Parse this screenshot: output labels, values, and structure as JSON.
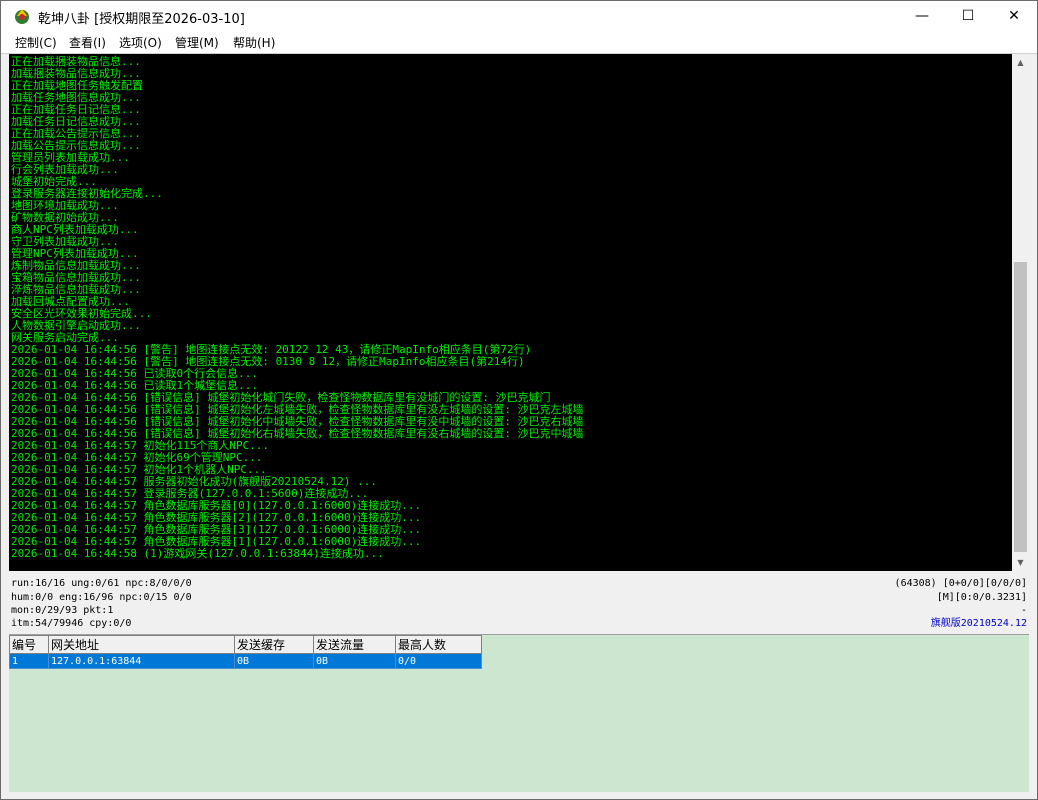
{
  "window": {
    "title": "乾坤八卦 [授权期限至2026-03-10]",
    "minimize_glyph": "—",
    "maximize_glyph": "☐",
    "close_glyph": "✕"
  },
  "menu": [
    "控制(C)",
    "查看(I)",
    "选项(O)",
    "管理(M)",
    "帮助(H)"
  ],
  "log_lines": [
    "正在加载捆装物品信息...",
    "加载捆装物品信息成功...",
    "正在加载地图任务触发配置",
    "加载任务地图信息成功...",
    "正在加载任务日记信息...",
    "加载任务日记信息成功...",
    "正在加载公告提示信息...",
    "加载公告提示信息成功...",
    "管理员列表加载成功...",
    "行会列表加载成功...",
    "城堡初始完成...",
    "登录服务器连接初始化完成...",
    "地图环境加载成功...",
    "矿物数据初始成功...",
    "商人NPC列表加载成功...",
    "守卫列表加载成功...",
    "管理NPC列表加载成功...",
    "炼制物品信息加载成功...",
    "宝箱物品信息加载成功...",
    "淬炼物品信息加载成功...",
    "加载回城点配置成功...",
    "安全区光环效果初始完成...",
    "人物数据引擎启动成功...",
    "网关服务启动完成...",
    "2026-01-04 16:44:56 [警告] 地图连接点无效: 20122 12 43，请修正MapInfo相应条目(第72行)",
    "2026-01-04 16:44:56 [警告] 地图连接点无效: 0130 8 12，请修正MapInfo相应条目(第214行)",
    "2026-01-04 16:44:56 已读取0个行会信息...",
    "2026-01-04 16:44:56 已读取1个城堡信息...",
    "2026-01-04 16:44:56 [错误信息] 城堡初始化城门失败，检查怪物数据库里有没城门的设置: 沙巴克城门",
    "2026-01-04 16:44:56 [错误信息] 城堡初始化左城墙失败，检查怪物数据库里有没左城墙的设置: 沙巴克左城墙",
    "2026-01-04 16:44:56 [错误信息] 城堡初始化中城墙失败，检查怪物数据库里有没中城墙的设置: 沙巴克右城墙",
    "2026-01-04 16:44:56 [错误信息] 城堡初始化右城墙失败，检查怪物数据库里有没右城墙的设置: 沙巴克中城墙",
    "2026-01-04 16:44:57 初始化115个商人NPC...",
    "2026-01-04 16:44:57 初始化69个管理NPC...",
    "2026-01-04 16:44:57 初始化1个机器人NPC...",
    "2026-01-04 16:44:57 服务器初始化成功(旗舰版20210524.12) ...",
    "2026-01-04 16:44:57 登录服务器(127.0.0.1:5600)连接成功...",
    "2026-01-04 16:44:57 角色数据库服务器[0](127.0.0.1:6000)连接成功...",
    "2026-01-04 16:44:57 角色数据库服务器[2](127.0.0.1:6000)连接成功...",
    "2026-01-04 16:44:57 角色数据库服务器[3](127.0.0.1:6000)连接成功...",
    "2026-01-04 16:44:57 角色数据库服务器[1](127.0.0.1:6000)连接成功...",
    "2026-01-04 16:44:58 (1)游戏网关(127.0.0.1:63844)连接成功..."
  ],
  "status": {
    "left": [
      "run:16/16 ung:0/61 npc:8/0/0/0",
      "hum:0/0 eng:16/96 npc:0/15 0/0",
      "mon:0/29/93 pkt:1",
      "itm:54/79946 cpy:0/0"
    ],
    "right": [
      "(64308) [0+0/0][0/0/0]",
      "[M][0:0/0.3231]",
      "-",
      "旗舰版20210524.12"
    ],
    "version_color": "#0000cc"
  },
  "gateway_table": {
    "headers": [
      "编号",
      "网关地址",
      "发送缓存",
      "发送流量",
      "最高人数"
    ],
    "rows": [
      [
        "1",
        "127.0.0.1:63844",
        "0B",
        "0B",
        "0/0"
      ]
    ]
  },
  "colors": {
    "log_text": "#00ee00",
    "log_bg": "#000000",
    "grid_bg": "#cde6cf",
    "selection": "#0078d7"
  }
}
